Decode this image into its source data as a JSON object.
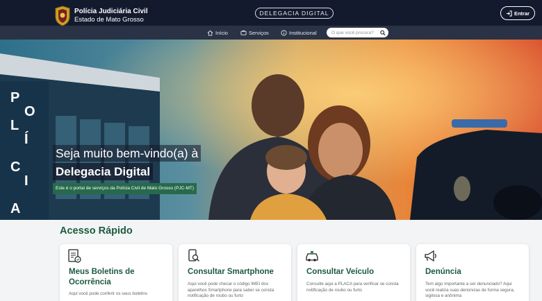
{
  "header": {
    "org_title": "Polícia Judiciária Civil",
    "org_subtitle": "Estado de Mato Grosso",
    "center_pill": "DELEGACIA DIGITAL",
    "login_label": "Entrar"
  },
  "nav": {
    "items": [
      {
        "label": "Início",
        "icon": "home-icon"
      },
      {
        "label": "Serviços",
        "icon": "services-icon"
      },
      {
        "label": "Institucional",
        "icon": "info-icon"
      }
    ],
    "search_placeholder": "O que você procura?"
  },
  "hero": {
    "welcome": "Seja muito bem-vindo(a) à",
    "title": "Delegacia Digital",
    "subtitle": "Este é o portal de serviços da Polícia Civil de Mato Grosso (PJC-MT)",
    "building_text": "POLÍCIA"
  },
  "quick_access": {
    "title": "Acesso Rápido",
    "cards": [
      {
        "title": "Meus Boletins de Ocorrência",
        "desc": "Aqui você pode conferir os seus boletins",
        "icon": "document-icon"
      },
      {
        "title": "Consultar Smartphone",
        "desc": "Aqui você pode checar o código IMEI dos aparelhos Smartphone para saber se consta notificação de roubo ou furto",
        "icon": "smartphone-icon"
      },
      {
        "title": "Consultar Veículo",
        "desc": "Consulte aqui a PLACA para verificar se consta notificação de roubo ou furto",
        "icon": "car-icon"
      },
      {
        "title": "Denúncia",
        "desc": "Tem algo importante a ser denunciado? Aqui você realiza suas denúncias de forma segura, sigilosa e anônima",
        "icon": "megaphone-icon"
      }
    ]
  },
  "colors": {
    "header_bg": "#141a2e",
    "nav_bg": "#2a3245",
    "accent_green": "#1d5a3f",
    "subtitle_green": "#276a4b"
  }
}
